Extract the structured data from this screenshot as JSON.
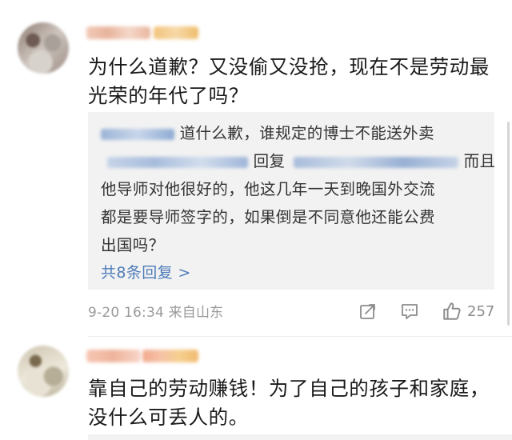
{
  "comments": [
    {
      "text_lines": [
        "为什么道歉？又没偷又没抢，现在不是劳动最",
        "光荣的年代了吗？"
      ],
      "replies": {
        "line1_text": "道什么歉，谁规定的博士不能送外卖",
        "line2_text_a": "回复",
        "line2_text_b": "而且",
        "line3_text": "他导师对他很好的，他这几年一天到晚国外交流",
        "line4_text": "都是要导师签字的，如果倒是不同意他还能公费",
        "line5_text": "出国吗？",
        "more_label": "共8条回复 >"
      },
      "meta": "9-20 16:34 来自山东",
      "actions": {
        "like_count": "257",
        "share_icon": "share-icon",
        "comment_icon": "comment-icon",
        "like_icon": "thumbs-up-icon"
      }
    },
    {
      "text_lines": [
        "靠自己的劳动赚钱！为了自己的孩子和家庭，",
        "没什么可丢人的。"
      ]
    }
  ],
  "colors": {
    "link": "#4f7cba",
    "meta": "#9a9a9a",
    "reply_bg": "#f2f2f2"
  }
}
